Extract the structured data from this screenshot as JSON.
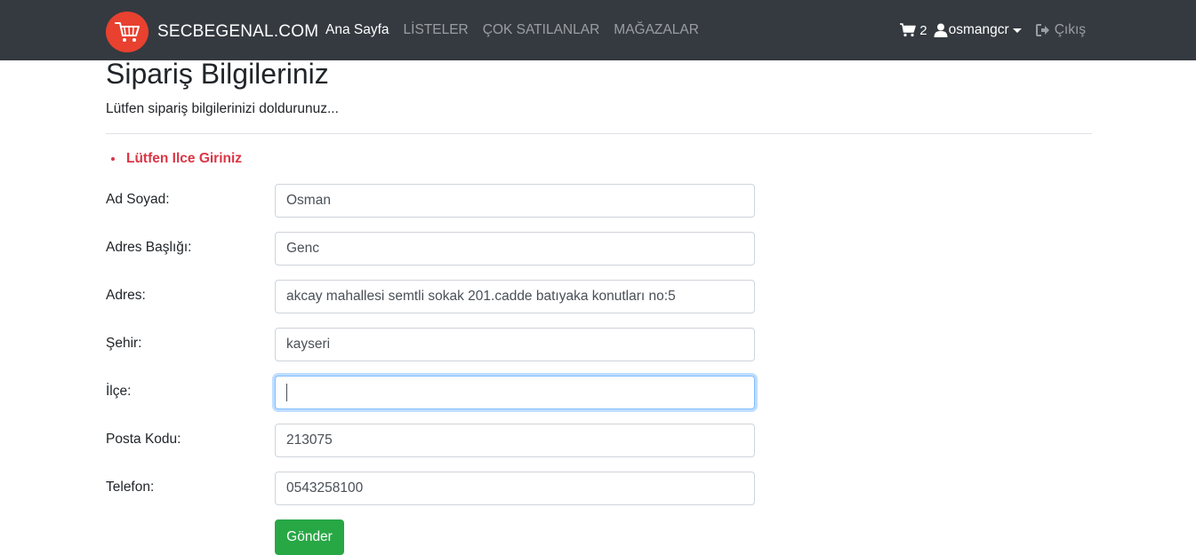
{
  "navbar": {
    "brand": "SECBEGENAL.COM",
    "links": [
      {
        "label": "Ana Sayfa",
        "active": true
      },
      {
        "label": "LİSTELER",
        "active": false
      },
      {
        "label": "ÇOK SATILANLAR",
        "active": false
      },
      {
        "label": "MAĞAZALAR",
        "active": false
      }
    ],
    "cart_count": "2",
    "username": "osmangcr",
    "logout_label": "Çıkış"
  },
  "page": {
    "title": "Sipariş Bilgileriniz",
    "subtitle": "Lütfen sipariş bilgilerinizi doldurunuz..."
  },
  "errors": [
    "Lütfen Ilce Giriniz"
  ],
  "form": {
    "fields": [
      {
        "label": "Ad Soyad:",
        "value": "Osman"
      },
      {
        "label": "Adres Başlığı:",
        "value": "Genc"
      },
      {
        "label": "Adres:",
        "value": "akcay mahallesi semtli sokak 201.cadde batıyaka konutları no:5"
      },
      {
        "label": "Şehir:",
        "value": "kayseri"
      },
      {
        "label": "İlçe:",
        "value": ""
      },
      {
        "label": "Posta Kodu:",
        "value": "213075"
      },
      {
        "label": "Telefon:",
        "value": "0543258100"
      }
    ],
    "submit_label": "Gönder"
  },
  "colors": {
    "navbar_bg": "#343a40",
    "brand_logo": "#e8412f",
    "error": "#dc3545",
    "submit": "#28a745"
  }
}
